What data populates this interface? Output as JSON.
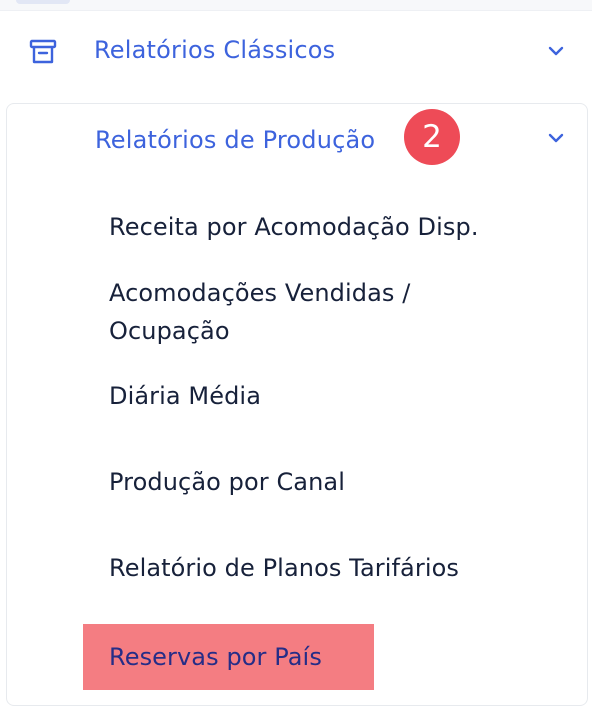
{
  "menu": {
    "classic_reports": {
      "label": "Relatórios Clássicos",
      "icon": "archive-box-icon",
      "state": "collapsed"
    },
    "production_reports": {
      "label": "Relatórios de Produção",
      "badge": "2",
      "state": "expanded"
    },
    "production_items": [
      {
        "label": "Receita por Acomodação Disp."
      },
      {
        "label": "Acomodações Vendidas / Ocupação"
      },
      {
        "label": "Diária Média"
      },
      {
        "label": "Produção por Canal"
      },
      {
        "label": "Relatório de Planos Tarifários"
      },
      {
        "label": "Reservas por País",
        "highlighted": true
      }
    ]
  },
  "colors": {
    "accent": "#3d63dd",
    "text": "#17213a",
    "badge": "#ee4b57",
    "highlight": "#f47d82"
  }
}
